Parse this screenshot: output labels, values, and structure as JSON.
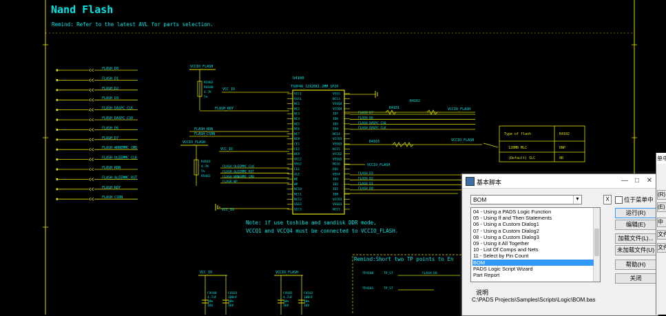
{
  "schematic": {
    "title": "Nand Flash",
    "remind": "Remind: Refer to the latest AVL for parts selection.",
    "left_nets": [
      "FLASH_D0",
      "FLASH_D1",
      "FLASH_D2",
      "FLASH_D3",
      "FLASH_DASPC_CLK",
      "FLASH_DASPC_CS0",
      "FLASH_D6",
      "FLASH_D7",
      "FLASH_WRNEMMC_CMD",
      "FLASH_OLEEMMC_CLK",
      "FLASH_RDN",
      "FLASH_ALEEMMC_RST",
      "FLASH_RDY",
      "FLASH_CS0N"
    ],
    "vccio_flash": "VCCIO_FLASH",
    "vcc_io": "VCC_IO",
    "ic_ref": "U4100",
    "ic_part": "TSOP48_12X20X1.2MM_1P20",
    "res_top": [
      "R5402",
      "R4100",
      "4.7K",
      "5%"
    ],
    "res_left": [
      "R4101",
      "4.7K",
      "5%",
      "R5402"
    ],
    "flash_rdy": "FLASH_RDY",
    "flash_rdn": "FLASH_RDN",
    "flash_cs0n": "FLASH_CS0N",
    "ic_left_pins": [
      "VCC1",
      "VSS1",
      "NC1",
      "NC2",
      "NC3",
      "NC4",
      "NC5",
      "NC6",
      "NC7",
      "NC8",
      "CE1",
      "CE2",
      "NC9",
      "VCC2",
      "VSS2",
      "CLE",
      "ALE",
      "WE",
      "WP",
      "NC10",
      "NC11",
      "NC12",
      "VSS3",
      "VCC3"
    ],
    "ic_right_pins": [
      "VSS5",
      "NC13",
      "VSSQ4",
      "VCCQ4",
      "IO7",
      "IO6",
      "IO5",
      "IO4",
      "NC14",
      "VCCQ3",
      "VSSQ3",
      "NC15",
      "VCCQ2",
      "VSSQ2",
      "NC16",
      "DQS",
      "VSS4",
      "IO3",
      "IO2",
      "IO1",
      "IO0",
      "VCCQ1",
      "VSSQ1",
      "NC17"
    ],
    "mid_nets": [
      "FLASH_OLEEMMC_CLK",
      "FLASH_ALEEMMC_RST",
      "FLASH_WRNEMMC_CMD",
      "FLASH_WP"
    ],
    "right_nets": [
      "FLASH_D7",
      "FLASH_D6",
      "FLASH_DASPC_CS0",
      "FLASH_DASPC_CLK",
      "FLASH_D3",
      "FLASH_D2",
      "FLASH_D1",
      "FLASH_D0"
    ],
    "r4101": "R4101",
    "r4102": "R4102",
    "r4103": "R4103",
    "table_header": [
      "Type of flash",
      "R4102"
    ],
    "table_row1": [
      "128MB MLC",
      "DNP"
    ],
    "table_row2": [
      "(Default)\nSLC",
      "0R"
    ],
    "note1": "Note: if use toshiba and sandisk DDR mode,",
    "note2": "VCCQ1 and VCCQ4 must be connected to VCCIO_FLASH.",
    "remind2": "Remind:Short two TP points to En",
    "tp_labels": [
      "TP4100",
      "TP4101"
    ],
    "tp_nets": [
      "TP_S7",
      "TP_S7"
    ],
    "flash_d0": "FLASH_D0",
    "caps_left": {
      "net": "VCC_IO",
      "refs": [
        "C4100",
        "C4101"
      ],
      "vals": [
        "4.7uF",
        "100nF"
      ],
      "tol": [
        "10%",
        "10%"
      ],
      "volt": [
        "16V",
        "16V"
      ]
    },
    "caps_right": {
      "net": "VCCIO_FLASH",
      "refs": [
        "C4102",
        "C4103"
      ],
      "vals": [
        "4.7uF",
        "100nF"
      ],
      "tol": [
        "10%",
        "10%"
      ],
      "volt": [
        "16V",
        "16V"
      ]
    }
  },
  "dialog": {
    "title": "基本脚本",
    "min": "—",
    "max": "□",
    "close": "✕",
    "combo_value": "BOM",
    "clear_button": "X",
    "checkbox_label": "位于菜单中",
    "list_items": [
      "04 - Using a PADS Logic Function",
      "05 - Using If and Then Statements",
      "06 - Using a Custom Dialog1",
      "07 - Using a Custom Dialog2",
      "08 - Using a Custom Dialog3",
      "09 - Using it All Together",
      "10 - List Of Comps and Nets",
      "11 - Select by Pin Count",
      "BOM",
      "PADS Logic Script Wizard",
      "Part Report"
    ],
    "selected_index": 8,
    "buttons": [
      "运行(R)",
      "编辑(E)",
      "加载文件(L)...",
      "未加载文件(U)",
      "帮助(H)",
      "关闭"
    ],
    "description_label": "说明",
    "path": "C:\\PADS Projects\\Samples\\Scripts\\Logic\\BOM.bas"
  },
  "dialog2": {
    "title": "单中",
    "buttons": [
      "(R)",
      "(E)",
      "中",
      "文件",
      "文件"
    ]
  }
}
